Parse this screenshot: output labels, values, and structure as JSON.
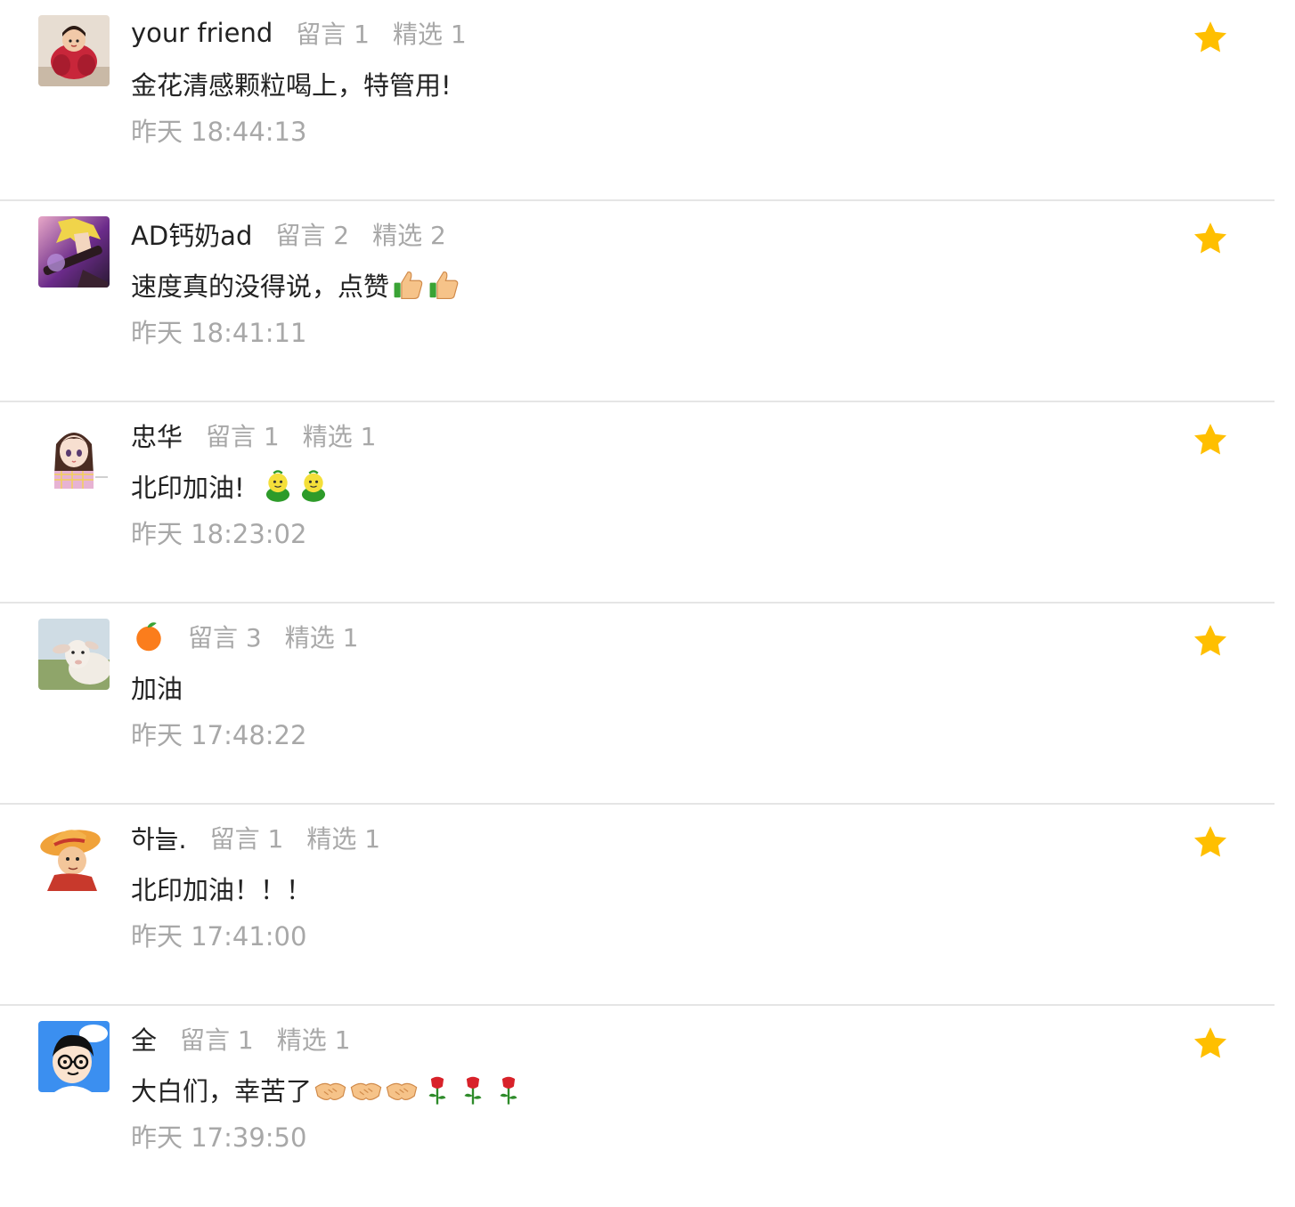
{
  "colors": {
    "star": "#FFBF00",
    "name": "#222222",
    "meta": "#A8A8A8",
    "divider": "#E5E5E5"
  },
  "comments": [
    {
      "name": "your friend",
      "msg_count": "留言 1",
      "featured_count": "精选 1",
      "text": "金花清感颗粒喝上，特管用!",
      "time": "昨天 18:44:13",
      "avatar": "red-plush-figure-avatar",
      "emojis": [],
      "starred": true
    },
    {
      "name": "AD钙奶ad",
      "msg_count": "留言 2",
      "featured_count": "精选 2",
      "text": "速度真的没得说，点赞",
      "time": "昨天 18:41:11",
      "avatar": "anime-guitarist-avatar",
      "emojis": [
        "thumbs-up-icon",
        "thumbs-up-icon"
      ],
      "starred": true
    },
    {
      "name": "忠华",
      "msg_count": "留言 1",
      "featured_count": "精选 1",
      "text": "北印加油!",
      "time": "昨天 18:23:02",
      "avatar": "anime-girl-avatar",
      "emojis": [
        "green-sprout-icon",
        "green-sprout-icon"
      ],
      "starred": true
    },
    {
      "name": "",
      "name_icon": "tangerine-icon",
      "msg_count": "留言 3",
      "featured_count": "精选 1",
      "text": "加油",
      "time": "昨天 17:48:22",
      "avatar": "lamb-avatar",
      "emojis": [],
      "starred": true
    },
    {
      "name": "하늘.",
      "msg_count": "留言 1",
      "featured_count": "精选 1",
      "text": "北印加油！！！",
      "time": "昨天 17:41:00",
      "avatar": "straw-hat-boy-avatar",
      "emojis": [],
      "starred": true
    },
    {
      "name": "全",
      "msg_count": "留言 1",
      "featured_count": "精选 1",
      "text": "大白们，幸苦了",
      "time": "昨天 17:39:50",
      "avatar": "cartoon-glasses-avatar",
      "emojis": [
        "handshake-icon",
        "handshake-icon",
        "handshake-icon",
        "rose-icon",
        "rose-icon",
        "rose-icon"
      ],
      "starred": true
    }
  ]
}
